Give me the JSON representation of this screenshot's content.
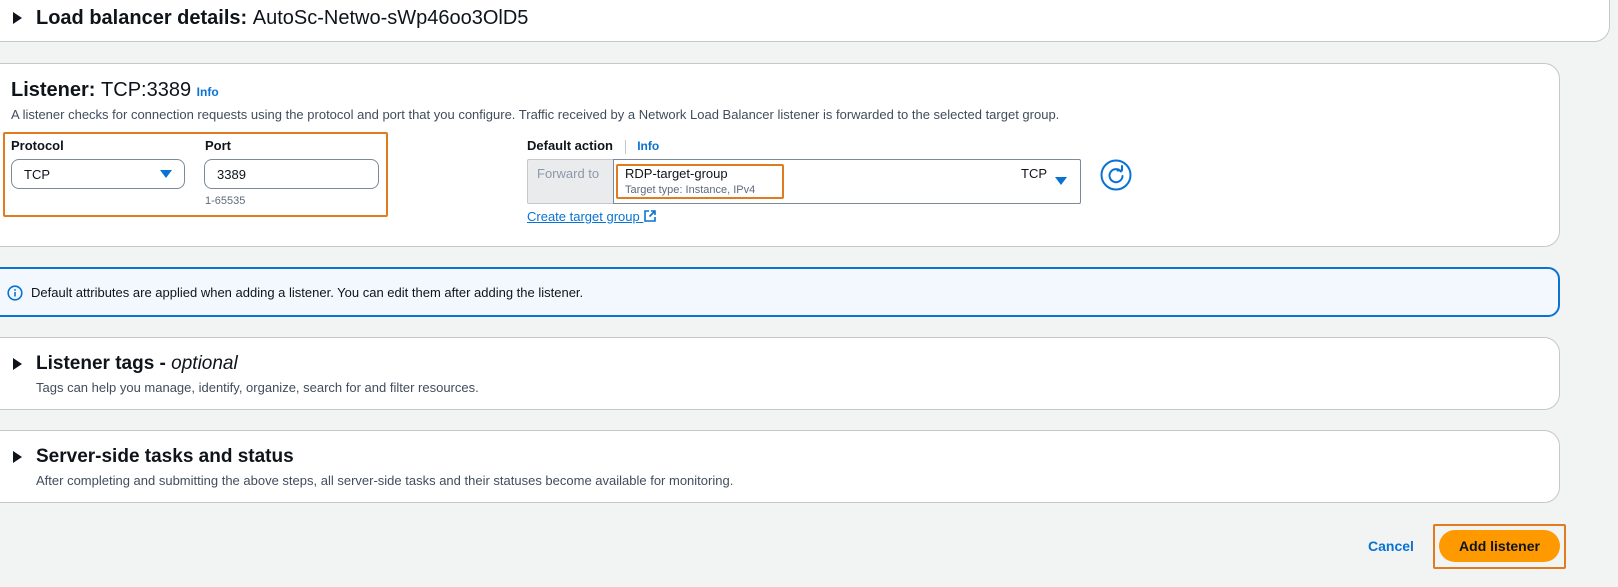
{
  "lb_details": {
    "label": "Load balancer details:",
    "value": "AutoSc-Netwo-sWp46oo3OlD5"
  },
  "listener": {
    "title": "Listener:",
    "value": "TCP:3389",
    "info": "Info",
    "description": "A listener checks for connection requests using the protocol and port that you configure. Traffic received by a Network Load Balancer listener is forwarded to the selected target group.",
    "protocol_label": "Protocol",
    "protocol_value": "TCP",
    "port_label": "Port",
    "port_value": "3389",
    "port_hint": "1-65535",
    "default_action_label": "Default action",
    "default_action_info": "Info",
    "forward_to": "Forward to",
    "target_group_name": "RDP-target-group",
    "target_group_type": "Target type: Instance, IPv4",
    "target_group_protocol": "TCP",
    "create_target_group": "Create target group"
  },
  "alert": {
    "text": "Default attributes are applied when adding a listener. You can edit them after adding the listener."
  },
  "listener_tags": {
    "title": "Listener tags -",
    "optional": "optional",
    "description": "Tags can help you manage, identify, organize, search for and filter resources."
  },
  "server_tasks": {
    "title": "Server-side tasks and status",
    "description": "After completing and submitting the above steps, all server-side tasks and their statuses become available for monitoring."
  },
  "footer": {
    "cancel": "Cancel",
    "add_listener": "Add listener"
  },
  "colors": {
    "accent": "#0972d3",
    "highlight": "#e07b1f",
    "primary": "#ff9900"
  }
}
